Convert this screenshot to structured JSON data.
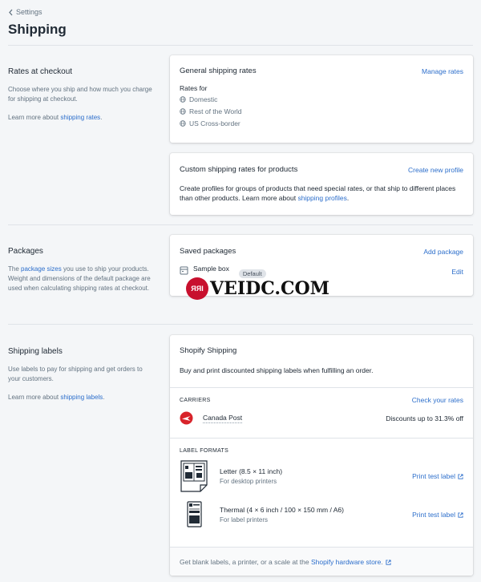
{
  "nav": {
    "back_label": "Settings"
  },
  "page": {
    "title": "Shipping"
  },
  "rates_section": {
    "heading": "Rates at checkout",
    "description": "Choose where you ship and how much you charge for shipping at checkout.",
    "learn_prefix": "Learn more about ",
    "learn_link": "shipping rates",
    "learn_suffix": "."
  },
  "general_rates": {
    "title": "General shipping rates",
    "action": "Manage rates",
    "rates_for": "Rates for",
    "zones": [
      "Domestic",
      "Rest of the World",
      "US Cross-border"
    ]
  },
  "custom_rates": {
    "title": "Custom shipping rates for products",
    "action": "Create new profile",
    "description": "Create profiles for groups of products that need special rates, or that ship to different places than other products. Learn more about ",
    "link": "shipping profiles",
    "suffix": "."
  },
  "packages_section": {
    "heading": "Packages",
    "desc_prefix": "The ",
    "desc_link": "package sizes",
    "desc_suffix": " you use to ship your products. Weight and dimensions of the default package are used when calculating shipping rates at checkout."
  },
  "saved_packages": {
    "title": "Saved packages",
    "action": "Add package",
    "package_name": "Sample box",
    "badge": "Default",
    "edit": "Edit"
  },
  "labels_section": {
    "heading": "Shipping labels",
    "description": "Use labels to pay for shipping and get orders to your customers.",
    "learn_prefix": "Learn more about ",
    "learn_link": "shipping labels",
    "learn_suffix": "."
  },
  "shopify_shipping": {
    "title": "Shopify Shipping",
    "description": "Buy and print discounted shipping labels when fulfilling an order.",
    "carriers_heading": "CARRIERS",
    "carriers_action": "Check your rates",
    "carrier_name": "Canada Post",
    "carrier_discount": "Discounts up to 31.3% off",
    "formats_heading": "LABEL FORMATS",
    "formats": [
      {
        "name": "Letter (8.5 × 11 inch)",
        "detail": "For desktop printers",
        "action": "Print test label"
      },
      {
        "name": "Thermal (4 × 6 inch / 100 × 150 mm / A6)",
        "detail": "For label printers",
        "action": "Print test label"
      }
    ],
    "footer_prefix": "Get blank labels, a printer, or a scale at the ",
    "footer_link": "Shopify hardware store",
    "footer_suffix": "."
  },
  "watermark": {
    "badge": "ЯЯI",
    "text": "VEIDC.COM"
  },
  "colors": {
    "link": "#2c6ecb",
    "canada_post_red": "#d8232a",
    "background": "#f4f6f8"
  }
}
